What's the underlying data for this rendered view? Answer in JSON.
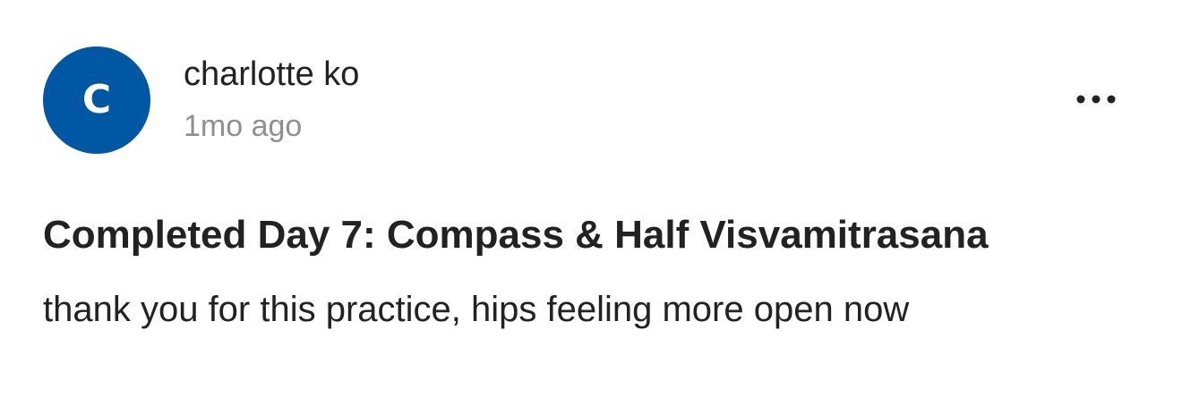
{
  "post": {
    "author": {
      "name": "charlotte ko",
      "avatar_letter": "c",
      "avatar_color": "#0057a3"
    },
    "timestamp": "1mo ago",
    "more_icon": "more-horizontal-icon",
    "title": "Completed Day 7: Compass & Half Visvamitrasana",
    "body": "thank you for this practice, hips feeling more open now"
  }
}
